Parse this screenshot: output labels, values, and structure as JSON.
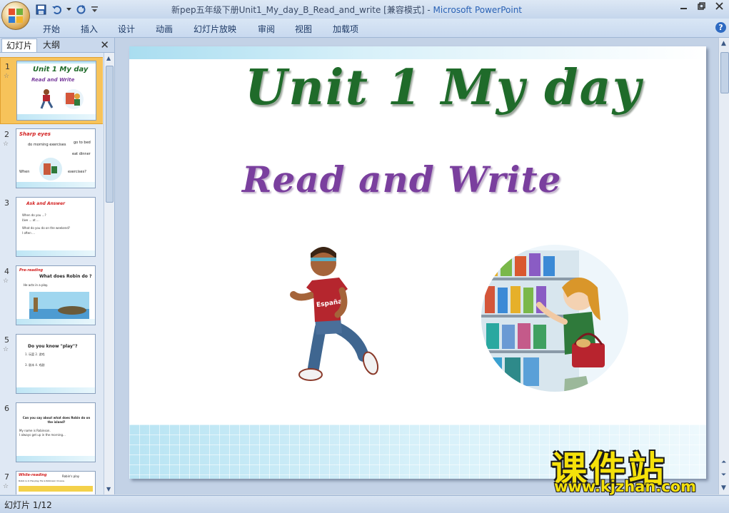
{
  "window": {
    "title": "新pep五年级下册Unit1_My_day_B_Read_and_write [兼容模式]",
    "app_name": "Microsoft PowerPoint"
  },
  "quick_access": {
    "icons": [
      "save-icon",
      "undo-icon",
      "dropdown-arrow-icon",
      "redo-icon",
      "customize-icon"
    ]
  },
  "ribbon": {
    "tabs": [
      "开始",
      "插入",
      "设计",
      "动画",
      "幻灯片放映",
      "审阅",
      "视图",
      "加载项"
    ],
    "help_label": "?"
  },
  "left_pane": {
    "tabs": [
      "幻灯片",
      "大纲"
    ],
    "close_label": "✕",
    "thumbnails": [
      {
        "number": "1",
        "title": "Unit 1 My day",
        "subtitle": "Read and Write"
      },
      {
        "number": "2",
        "title": "Sharp eyes",
        "lines": [
          "do morning exercises",
          "go to bed",
          "eat dinner",
          "When",
          "exercises?"
        ]
      },
      {
        "number": "3",
        "title": "Ask and Answer",
        "lines": [
          "When do you ...?",
          "I/we ... at ...",
          "What do you do on the weekend?",
          "I often ..."
        ]
      },
      {
        "number": "4",
        "title": "Pre-reading",
        "lines": [
          "What does Robin do ?",
          "He acts in a play."
        ]
      },
      {
        "number": "5",
        "title": "Do you know \"play\"?",
        "lines": [
          "1. 玩耍  2. 游戏",
          "3. 剧本  4. 戏剧"
        ]
      },
      {
        "number": "6",
        "title": "Can you say about what does Robin do on the island?",
        "lines": [
          "My name is Robinson.",
          "I always get up in the morning..."
        ]
      },
      {
        "number": "7",
        "title": "While-reading",
        "lines": [
          "Robin's play",
          "Robin is in the play. He is Robinson Crusoe."
        ]
      }
    ]
  },
  "slide": {
    "title": "Unit 1 My day",
    "subtitle": "Read and Write",
    "boy_shirt_text": "España"
  },
  "status_bar": {
    "slide_info": "幻灯片 1/12"
  },
  "watermark": {
    "cn": "课件站",
    "url": "www.kjzhan.com"
  },
  "colors": {
    "title_green": "#1f6b2a",
    "subtitle_purple": "#7a3f9e",
    "selected_thumb": "#f7c35a",
    "watermark_yellow": "#f5e10a"
  }
}
